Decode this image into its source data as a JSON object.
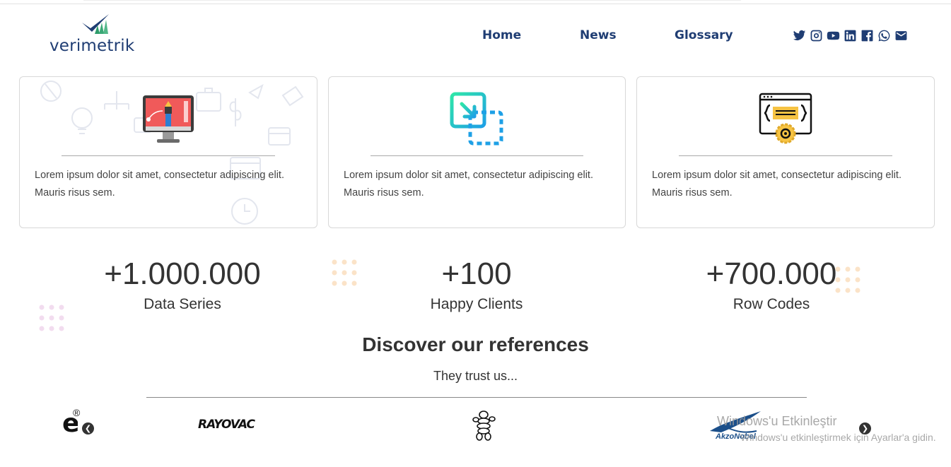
{
  "header": {
    "logo_text": "verimetrik",
    "nav": {
      "home": "Home",
      "news": "News",
      "glossary": "Glossary"
    },
    "social_icons": [
      "twitter-icon",
      "instagram-icon",
      "youtube-icon",
      "linkedin-icon",
      "facebook-icon",
      "whatsapp-icon",
      "mail-icon"
    ]
  },
  "cards": [
    {
      "icon": "design-monitor-icon",
      "text": "Lorem ipsum dolor sit amet, consectetur adipiscing elit. Mauris risus sem."
    },
    {
      "icon": "resize-arrow-icon",
      "text": "Lorem ipsum dolor sit amet, consectetur adipiscing elit. Mauris risus sem."
    },
    {
      "icon": "code-settings-icon",
      "text": "Lorem ipsum dolor sit amet, consectetur adipiscing elit. Mauris risus sem."
    }
  ],
  "stats": [
    {
      "value": "+1.000.000",
      "label": "Data Series"
    },
    {
      "value": "+100",
      "label": "Happy Clients"
    },
    {
      "value": "+700.000",
      "label": "Row Codes"
    }
  ],
  "references": {
    "title": "Discover our references",
    "subtitle": "They trust us...",
    "logos": {
      "partial": "e",
      "registered": "®",
      "rayovac": "RAYOVAC",
      "akzonobel": "AkzoNobel"
    },
    "prev_icon": "chevron-left-icon",
    "next_icon": "chevron-right-icon"
  },
  "watermark": {
    "line1": "Windows'u Etkinleştir",
    "line2": "Windows'u etkinleştirmek için Ayarlar'a gidin."
  },
  "colors": {
    "brand": "#1f3d73",
    "accent_teal": "#2ec4b6",
    "accent_blue": "#1ea0e6",
    "accent_red": "#f05a5a"
  }
}
